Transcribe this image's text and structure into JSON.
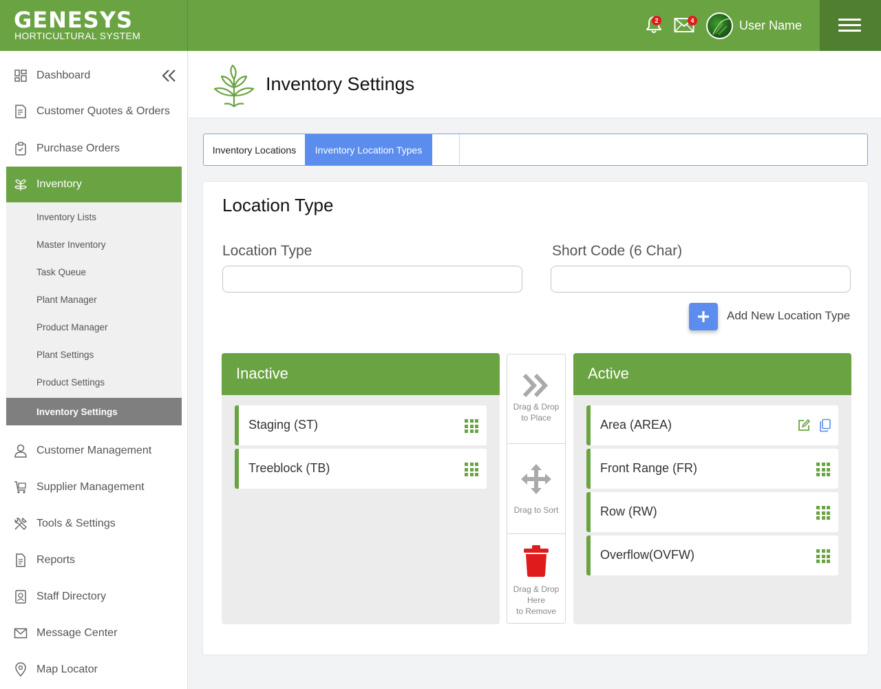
{
  "brand": {
    "name": "GENESYS",
    "subtitle": "HORTICULTURAL SYSTEM"
  },
  "header": {
    "notifications_count": "2",
    "messages_count": "4",
    "user_name": "User Name"
  },
  "sidebar": {
    "items_top": [
      {
        "label": "Dashboard",
        "icon": "dashboard-icon"
      },
      {
        "label": "Customer Quotes & Orders",
        "icon": "document-icon"
      },
      {
        "label": "Purchase Orders",
        "icon": "clipboard-check-icon"
      },
      {
        "label": "Inventory",
        "icon": "plant-icon",
        "active": true
      }
    ],
    "inventory_sub": [
      {
        "label": "Inventory Lists"
      },
      {
        "label": "Master Inventory"
      },
      {
        "label": "Task Queue"
      },
      {
        "label": "Plant Manager"
      },
      {
        "label": "Product Manager"
      },
      {
        "label": "Plant Settings"
      },
      {
        "label": "Product Settings"
      },
      {
        "label": "Inventory Settings",
        "active": true
      }
    ],
    "items_bottom": [
      {
        "label": "Customer Management",
        "icon": "user-icon"
      },
      {
        "label": "Supplier Management",
        "icon": "cart-icon"
      },
      {
        "label": "Tools & Settings",
        "icon": "tools-icon"
      },
      {
        "label": "Reports",
        "icon": "report-icon"
      },
      {
        "label": "Staff Directory",
        "icon": "contact-icon"
      },
      {
        "label": "Message Center",
        "icon": "mail-icon"
      },
      {
        "label": "Map Locator",
        "icon": "map-pin-icon"
      }
    ]
  },
  "page": {
    "title": "Inventory Settings"
  },
  "tabs": [
    {
      "label": "Inventory Locations"
    },
    {
      "label": "Inventory Location Types",
      "active": true
    }
  ],
  "form": {
    "title": "Location Type",
    "location_type_label": "Location Type",
    "location_type_value": "",
    "short_code_label": "Short Code (6 Char)",
    "short_code_value": "",
    "add_label": "Add New Location Type"
  },
  "inactive": {
    "title": "Inactive",
    "items": [
      "Staging (ST)",
      "Treeblock (TB)"
    ]
  },
  "active": {
    "title": "Active",
    "items": [
      "Area (AREA)",
      "Front Range (FR)",
      "Row (RW)",
      "Overflow(OVFW)"
    ]
  },
  "middle": {
    "place_line1": "Drag & Drop",
    "place_line2": "to Place",
    "sort": "Drag to Sort",
    "remove_line1": "Drag & Drop",
    "remove_line2": "Here",
    "remove_line3": "to Remove"
  },
  "colors": {
    "brand_green": "#6aa342",
    "accent_blue": "#5b8def",
    "danger_red": "#e01b1b"
  }
}
